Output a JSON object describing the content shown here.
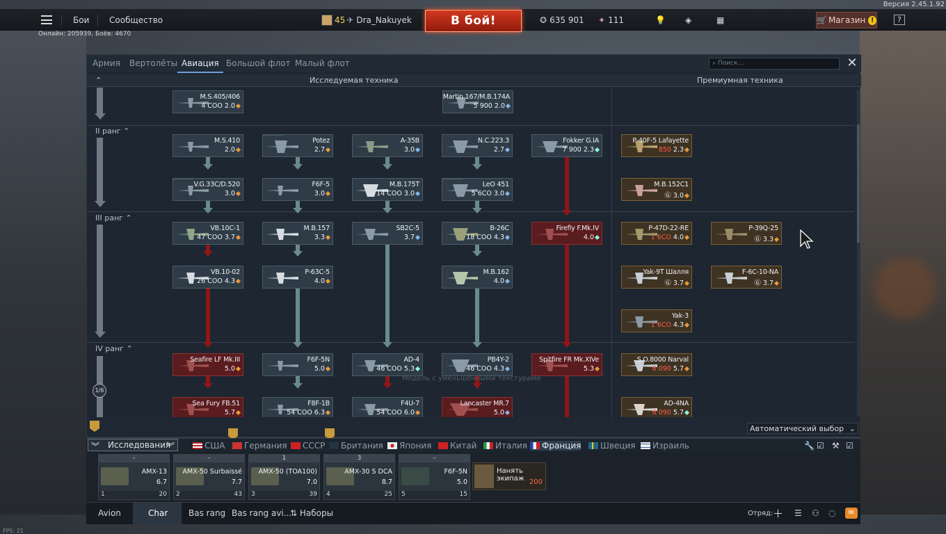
{
  "version": "Версия 2.45.1.92",
  "topbar": {
    "menu_battles": "Бои",
    "menu_community": "Сообщество",
    "player_level": "45",
    "player_name": "Dra_Nakuyek",
    "play_button": "В бой!",
    "silver_lions": "635 901",
    "golden_eagles": "111",
    "shop": "Магазин",
    "shop_alert": "!",
    "help": "?"
  },
  "online": "Онлайн: 205939, Боёв: 4670",
  "tabs": [
    "Армия",
    "Вертолёты",
    "Авиация",
    "Большой флот",
    "Малый флот"
  ],
  "active_tab": "Авиация",
  "search_placeholder": "Поиск...",
  "headers": {
    "researchable": "Исследуемая техника",
    "premium": "Премиумная техника"
  },
  "ranks": [
    "II ранг",
    "III ранг",
    "IV ранг"
  ],
  "research_fraction": "1/6",
  "vehicles": {
    "ms405": {
      "name": "M.S.405/406",
      "cost": "4 СОО",
      "br": "2.0"
    },
    "martin167": {
      "name": "Martin 167/M.B.174A",
      "cost": "5 900",
      "br": "2.0"
    },
    "ms410": {
      "name": "M.S.410",
      "cost": "",
      "br": "2.0"
    },
    "potez": {
      "name": "Potez",
      "cost": "",
      "br": "2.7"
    },
    "a35b": {
      "name": "A-35B",
      "cost": "",
      "br": "3.0"
    },
    "nc223": {
      "name": "N.C.223.3",
      "cost": "",
      "br": "2.7"
    },
    "fokker": {
      "name": "Fokker G.IA",
      "cost": "7 900",
      "br": "2.3"
    },
    "vg33": {
      "name": "V.G.33C/D.520",
      "cost": "",
      "br": "3.0"
    },
    "f6f5": {
      "name": "F6F-5",
      "cost": "",
      "br": "3.0"
    },
    "mb175": {
      "name": "M.B.175T",
      "cost": "14 СОО",
      "br": "3.0"
    },
    "leo451": {
      "name": "LeO 451",
      "cost": "5 6СО",
      "br": "3.0"
    },
    "vb10c": {
      "name": "VB.10C-1",
      "cost": "47 СОО",
      "br": "3.7"
    },
    "mb157": {
      "name": "M.B.157",
      "cost": "",
      "br": "3.3"
    },
    "sb2c": {
      "name": "SB2C-5",
      "cost": "",
      "br": "3.7"
    },
    "b26c": {
      "name": "B-26C",
      "cost": "18 СОО",
      "br": "4.3"
    },
    "firefly": {
      "name": "Firefly F.Mk.IV",
      "cost": "",
      "br": "4.0"
    },
    "vb1002": {
      "name": "VB.10-02",
      "cost": "26 СОО",
      "br": "4.3"
    },
    "p63c": {
      "name": "P-63C-5",
      "cost": "",
      "br": "4.0"
    },
    "mb162": {
      "name": "M.B.162",
      "cost": "",
      "br": "4.0"
    },
    "seafire": {
      "name": "Seafire LF Mk.III",
      "cost": "",
      "br": "5.0"
    },
    "f6f5n": {
      "name": "F6F-5N",
      "cost": "",
      "br": "5.0"
    },
    "ad4": {
      "name": "AD-4",
      "cost": "46 СОО",
      "br": "5.3"
    },
    "pb4y": {
      "name": "PB4Y-2",
      "cost": "46 СОО",
      "br": "4.3"
    },
    "spitfire": {
      "name": "Spitfire FR Mk.XIVe",
      "cost": "",
      "br": "5.3"
    },
    "seafury": {
      "name": "Sea Fury FB.51",
      "cost": "",
      "br": "5.7"
    },
    "f8f": {
      "name": "F8F-1B",
      "cost": "54 СОО",
      "br": "6.3"
    },
    "f4u7": {
      "name": "F4U-7",
      "cost": "54 СОО",
      "br": "6.0"
    },
    "lancaster": {
      "name": "Lancaster MR.7",
      "cost": "",
      "br": "5.0"
    },
    "p40": {
      "name": "P-40F-5 Lafayette",
      "cost": "850",
      "br": "2.3"
    },
    "mb152": {
      "name": "M.B.152C1",
      "cost": "Ⓖ",
      "br": "3.0"
    },
    "p47": {
      "name": "P-47D-22-RE",
      "cost": "1 6СО",
      "br": "4.0"
    },
    "p39": {
      "name": "P-39Q-25",
      "cost": "Ⓖ",
      "br": "3.3"
    },
    "yak9t": {
      "name": "Yak-9T Шалля",
      "cost": "Ⓖ",
      "br": "3.7"
    },
    "f6c": {
      "name": "F-6C-10-NA",
      "cost": "Ⓖ",
      "br": "3.7"
    },
    "yak3": {
      "name": "Yak-3",
      "cost": "1 6СО",
      "br": "4.3"
    },
    "so8000": {
      "name": "S.O.8000 Narval",
      "cost": "6 090",
      "br": "5.7"
    },
    "ad4na": {
      "name": "AD-4NA",
      "cost": "6 090",
      "br": "5.7"
    }
  },
  "overlay_text": "Модель с уменьшенными текстурами",
  "auto_select": "Автоматический выбор",
  "research_label": "Исследования",
  "nations": [
    "США",
    "Германия",
    "СССР",
    "Британия",
    "Япония",
    "Китай",
    "Италия",
    "Франция",
    "Швеция",
    "Израиль"
  ],
  "active_nation": "Франция",
  "crew": [
    {
      "top": "–",
      "name": "AMX-13",
      "br": "6.7",
      "num": "1",
      "count": "20"
    },
    {
      "top": "–",
      "name": "AMX-50 Surbaissé",
      "br": "7.7",
      "num": "2",
      "count": "43"
    },
    {
      "top": "1",
      "name": "AMX-50 (TOA100)",
      "br": "7.0",
      "num": "3",
      "count": "39"
    },
    {
      "top": "3",
      "name": "AMX-30 S DCA",
      "br": "8.7",
      "num": "4",
      "count": "25"
    },
    {
      "top": "–",
      "name": "F6F-5N",
      "br": "5.0",
      "num": "5",
      "count": "15"
    }
  ],
  "hire_crew": {
    "label": "Нанять экипаж",
    "cost": "200"
  },
  "bottom": {
    "tabs": [
      "Avion",
      "Char",
      "Bas rang",
      "Bas rang avi..."
    ],
    "presets": "Наборы",
    "squad": "Отряд:"
  },
  "fps": "FPS: 21",
  "colors": {
    "play": "#c0311b",
    "researchable": "#2f3c47",
    "premium": "#3e3222",
    "red_branch": "#8e1718",
    "teal_branch": "#6a8a8c"
  }
}
